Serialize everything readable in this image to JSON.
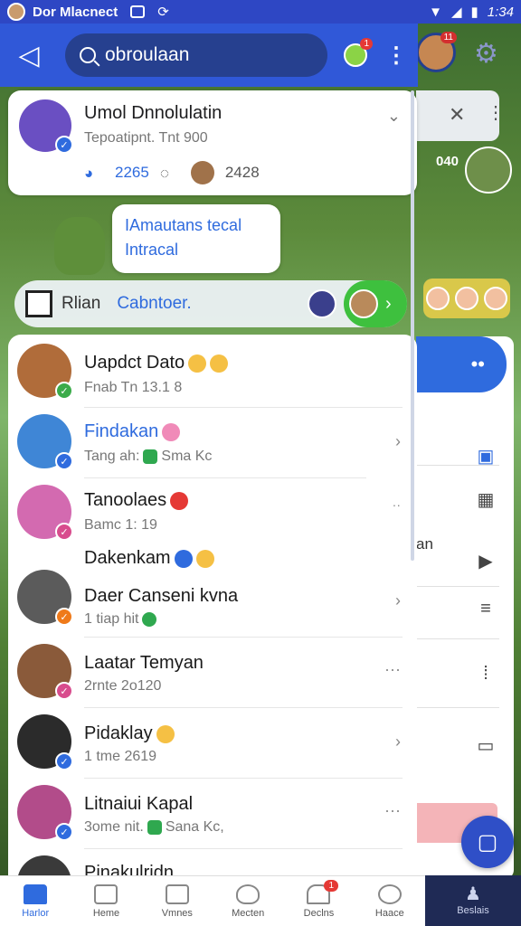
{
  "status_bar": {
    "title": "Dor Mlacnect",
    "time": "1:34"
  },
  "top_bar": {
    "search_value": "obroulaan",
    "emoji_badge": "1"
  },
  "profile_card": {
    "name": "Umol Dnnolulatin",
    "subtitle": "Tepoatipnt. Tnt 900",
    "stat_1": "2265",
    "stat_2": "2428"
  },
  "bubble": {
    "line1": "IAmautans tecal",
    "line2": "Intracal"
  },
  "feature_bar": {
    "label": "Rlian",
    "link": "Cabntoer."
  },
  "right_panel": {
    "count": "040",
    "peek_text": "an",
    "badge": "11"
  },
  "chats": [
    {
      "name": "Uapdct Dato",
      "meta": "Fnab Tn 13.1 8",
      "name_color": "dark",
      "trailing": ""
    },
    {
      "name": "Findakan",
      "meta_prefix": "Tang ah:",
      "meta_suffix": "Sma Kc",
      "name_color": "blue",
      "trailing": "›"
    },
    {
      "name": "Tanoolaes",
      "meta": "Bamc 1: 19",
      "name_color": "dark",
      "trailing": "··"
    },
    {
      "name": "Dakenkam",
      "meta": "",
      "name_color": "dark",
      "trailing": ""
    },
    {
      "name": "Daer Canseni kvna",
      "meta": "1 tiap hit",
      "name_color": "dark",
      "trailing": "›"
    },
    {
      "name": "Laatar Temyan",
      "meta": "2rnte 2o120",
      "name_color": "dark",
      "trailing": "···"
    },
    {
      "name": "Pidaklay",
      "meta": "1 tme 2619",
      "name_color": "dark",
      "trailing": "›"
    },
    {
      "name": "Litnaiui Kapal",
      "meta_prefix": "3ome nit.",
      "meta_suffix": "Sana Kc,",
      "name_color": "dark",
      "trailing": "···"
    },
    {
      "name": "Pinakulridn",
      "meta": "",
      "name_color": "dark",
      "trailing": ""
    }
  ],
  "bottom_nav": [
    {
      "label": "Harlor",
      "active": true
    },
    {
      "label": "Heme"
    },
    {
      "label": "Vmnes"
    },
    {
      "label": "Mecten"
    },
    {
      "label": "Declns",
      "badge": "1"
    },
    {
      "label": "Haace"
    }
  ],
  "right_nav_label": "Beslais",
  "colors": {
    "accent": "#3058d8",
    "brand_dark": "#26408f",
    "success": "#3ec03e",
    "badge": "#e53935"
  }
}
